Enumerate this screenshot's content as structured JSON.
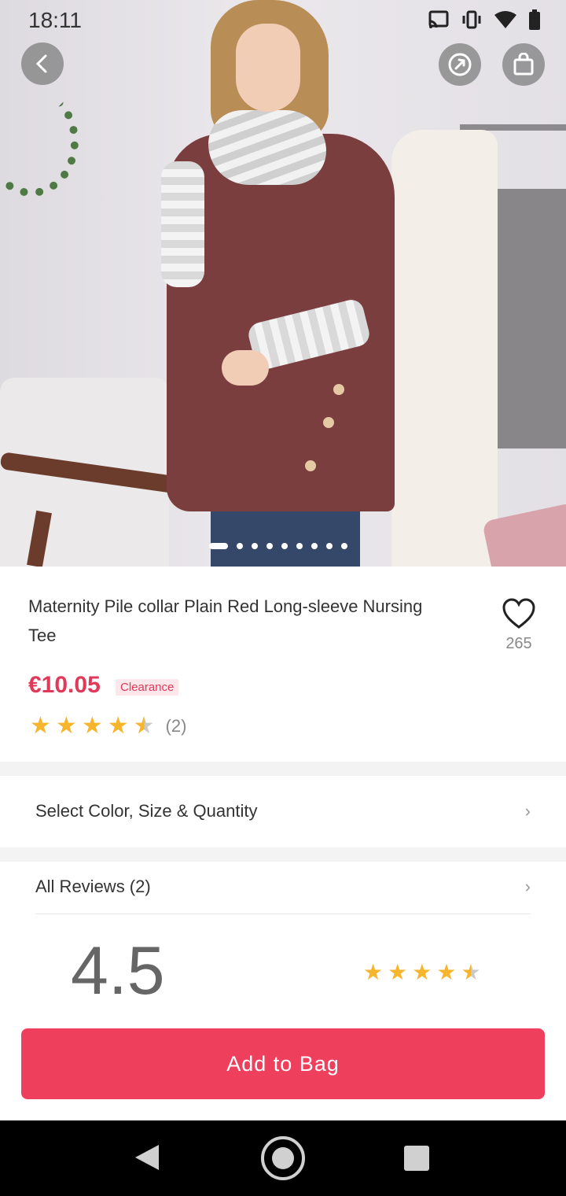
{
  "status_bar": {
    "time": "18:11"
  },
  "product": {
    "title": "Maternity Pile collar Plain Red Long-sleeve Nursing Tee",
    "favorites_count": "265",
    "price": "€10.05",
    "badge": "Clearance",
    "rating": 4.5,
    "review_count_label": "(2)",
    "image_count": 9,
    "active_image_index": 0
  },
  "options_row": {
    "label": "Select Color, Size & Quantity"
  },
  "reviews": {
    "label": "All Reviews (2)",
    "score": "4.5"
  },
  "cta": {
    "add_to_bag_label": "Add to Bag"
  },
  "icons": {
    "back": "back-arrow-icon",
    "share": "share-icon",
    "bag": "shopping-bag-icon",
    "favorite": "heart-icon",
    "chevron": "chevron-right-icon"
  },
  "colors": {
    "accent": "#ee3f5d",
    "price": "#e0395a",
    "star": "#f6b52c"
  }
}
